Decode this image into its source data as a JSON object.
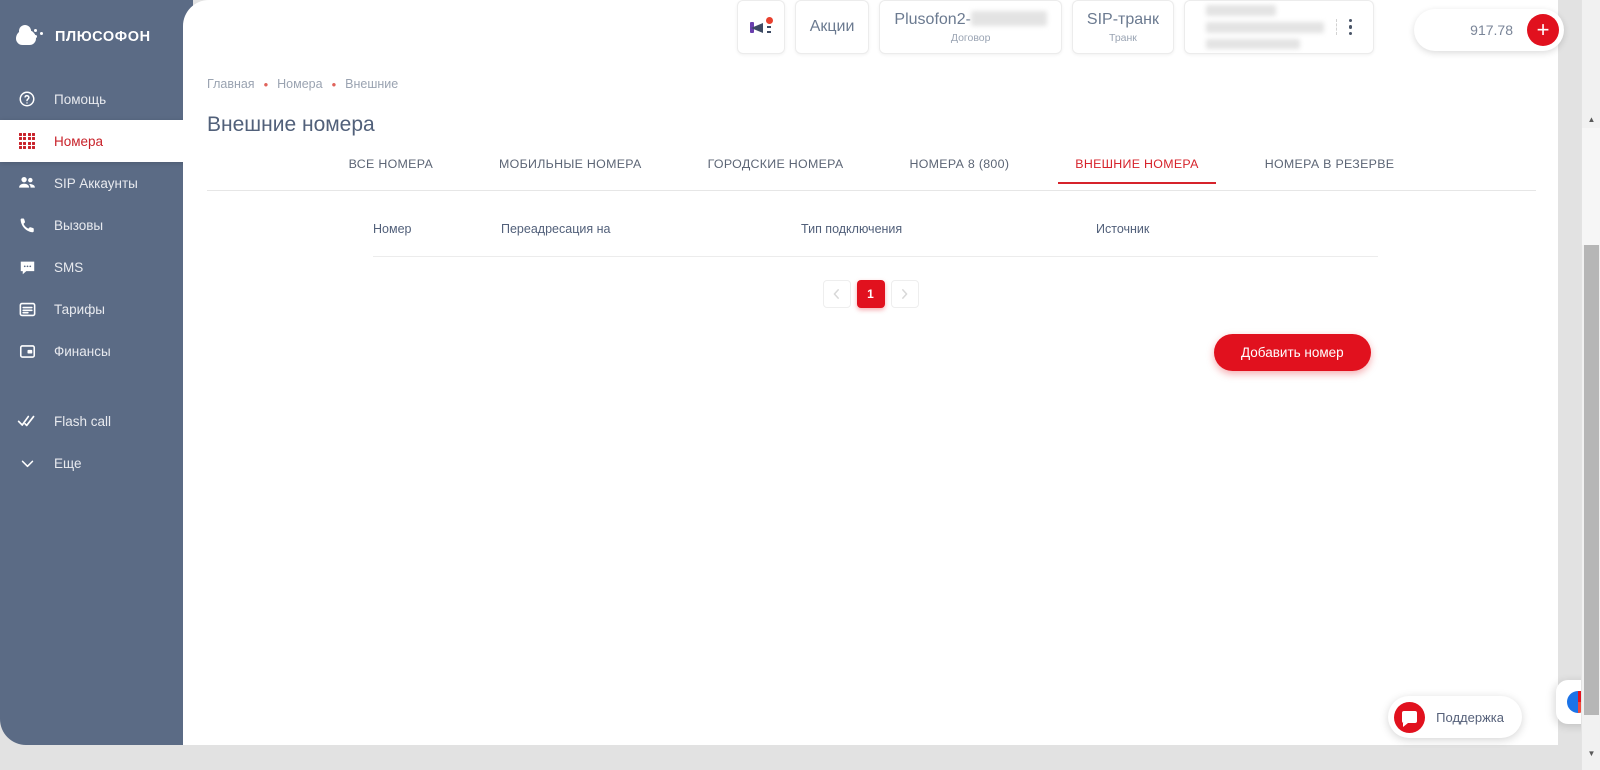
{
  "brand": {
    "name": "ПЛЮСОФОН",
    "logo_icon": "cloud-dots-logo"
  },
  "sidebar": {
    "collapse_button_icon": "chevron-left-icon",
    "items": [
      {
        "label": "Помощь",
        "icon": "question-circle-icon",
        "active": false
      },
      {
        "label": "Номера",
        "icon": "dot-grid-icon",
        "active": true
      },
      {
        "label": "SIP Аккаунты",
        "icon": "users-icon",
        "active": false
      },
      {
        "label": "Вызовы",
        "icon": "phone-icon",
        "active": false
      },
      {
        "label": "SMS",
        "icon": "chat-icon",
        "active": false
      },
      {
        "label": "Тарифы",
        "icon": "list-card-icon",
        "active": false
      },
      {
        "label": "Финансы",
        "icon": "wallet-icon",
        "active": false
      },
      {
        "label": "Flash call",
        "icon": "double-check-icon",
        "active": false
      },
      {
        "label": "Еще",
        "icon": "chevron-down-icon",
        "active": false
      }
    ]
  },
  "topbar": {
    "promo_icon": "megaphone-icon",
    "promo_badge": true,
    "actions_label": "Акции",
    "contract": {
      "title": "Plusofon2-",
      "subtitle": "Договор",
      "masked": true
    },
    "trunk": {
      "title": "SIP-транк",
      "subtitle": "Транк"
    },
    "account": {
      "masked": true,
      "menu_icon": "vertical-dots-icon"
    },
    "balance": {
      "value": "917.78",
      "add_icon": "plus-icon"
    }
  },
  "breadcrumb": {
    "separator": "•",
    "items": [
      "Главная",
      "Номера",
      "Внешние"
    ]
  },
  "page": {
    "title": "Внешние номера"
  },
  "tabs": [
    {
      "label": "ВСЕ НОМЕРА",
      "active": false
    },
    {
      "label": "МОБИЛЬНЫЕ НОМЕРА",
      "active": false
    },
    {
      "label": "ГОРОДСКИЕ НОМЕРА",
      "active": false
    },
    {
      "label": "НОМЕРА 8 (800)",
      "active": false
    },
    {
      "label": "ВНЕШНИЕ НОМЕРА",
      "active": true
    },
    {
      "label": "НОМЕРА В РЕЗЕРВЕ",
      "active": false
    }
  ],
  "table": {
    "columns": [
      "Номер",
      "Переадресация на",
      "Тип подключения",
      "Источник"
    ],
    "rows": []
  },
  "pagination": {
    "prev_icon": "chevron-left-icon",
    "next_icon": "chevron-right-icon",
    "pages": [
      "1"
    ],
    "current": "1"
  },
  "actions": {
    "add_number_label": "Добавить номер"
  },
  "support": {
    "label": "Поддержка",
    "icon": "chat-bubble-icon"
  },
  "corner_widget": {
    "icon": "color-circle-widget-icon"
  },
  "colors": {
    "sidebar": "#5b6b85",
    "accent_red": "#e1111e",
    "active_tab": "#d6232b",
    "collapse_button": "#d9756e",
    "title_text": "#51607a",
    "page_bg": "#e2e2e2"
  }
}
